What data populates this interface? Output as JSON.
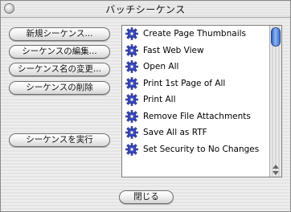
{
  "window": {
    "title": "バッチシーケンス"
  },
  "buttons": {
    "new": "新規シーケンス...",
    "edit": "シーケンスの編集...",
    "rename": "シーケンス名の変更...",
    "delete": "シーケンスの削除",
    "run": "シーケンスを実行",
    "close": "閉じる"
  },
  "sequences": [
    {
      "label": "Create Page Thumbnails",
      "icon": "gear-icon"
    },
    {
      "label": "Fast Web View",
      "icon": "gear-icon"
    },
    {
      "label": "Open All",
      "icon": "gear-icon"
    },
    {
      "label": "Print 1st Page of All",
      "icon": "gear-icon"
    },
    {
      "label": "Print All",
      "icon": "gear-icon"
    },
    {
      "label": "Remove File Attachments",
      "icon": "gear-icon"
    },
    {
      "label": "Save All as RTF",
      "icon": "gear-icon"
    },
    {
      "label": "Set Security to No Changes",
      "icon": "gear-icon"
    }
  ]
}
